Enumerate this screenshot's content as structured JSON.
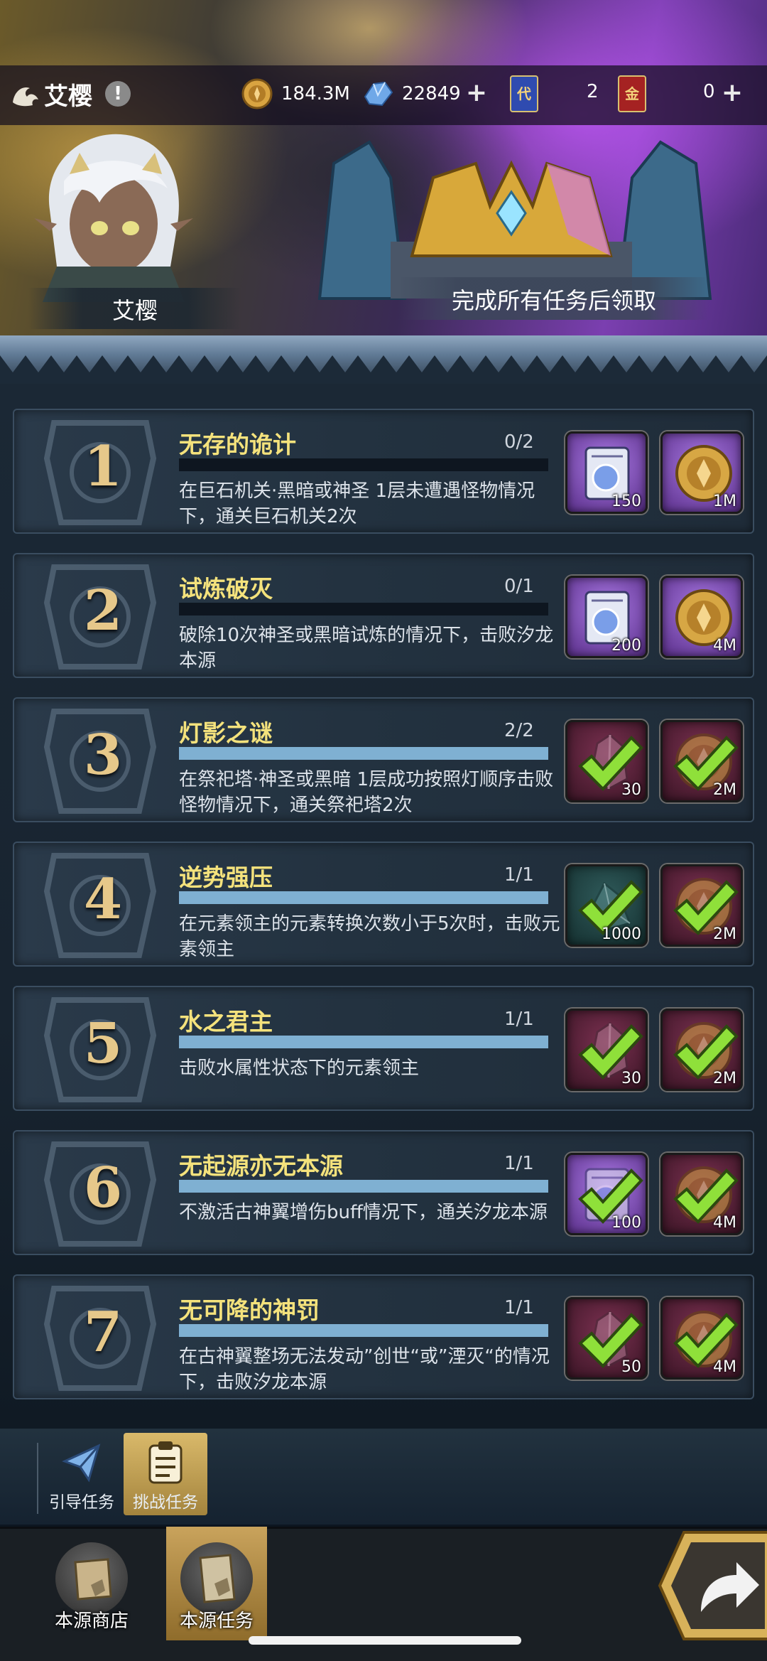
{
  "header": {
    "player_name": "艾樱",
    "info_badge": "!",
    "resources": {
      "gold": "184.3M",
      "crystal": "22849",
      "blue_card_label": "代",
      "blue_card": "2",
      "red_card_label": "金",
      "red_card": "0"
    },
    "plus": "+"
  },
  "hero": {
    "name": "艾樱"
  },
  "chest": {
    "caption": "完成所有任务后领取"
  },
  "tasks": [
    {
      "num": "1",
      "title": "无存的诡计",
      "progress": "0/2",
      "fraction": 0,
      "desc": "在巨石机关·黑暗或神圣 1层未遭遇怪物情况下，通关巨石机关2次",
      "rewards": [
        {
          "icon": "scroll-icon",
          "qty": "150"
        },
        {
          "icon": "gold-coin-icon",
          "qty": "1M"
        }
      ],
      "done": false
    },
    {
      "num": "2",
      "title": "试炼破灭",
      "progress": "0/1",
      "fraction": 0,
      "desc": "破除10次神圣或黑暗试炼的情况下，击败汐龙本源",
      "rewards": [
        {
          "icon": "scroll-icon",
          "qty": "200"
        },
        {
          "icon": "gold-coin-icon",
          "qty": "4M"
        }
      ],
      "done": false
    },
    {
      "num": "3",
      "title": "灯影之谜",
      "progress": "2/2",
      "fraction": 1,
      "desc": "在祭祀塔·神圣或黑暗 1层成功按照灯顺序击败怪物情况下，通关祭祀塔2次",
      "rewards": [
        {
          "icon": "crystal-icon",
          "qty": "30"
        },
        {
          "icon": "gold-coin-icon",
          "qty": "2M"
        }
      ],
      "done": true
    },
    {
      "num": "4",
      "title": "逆势强压",
      "progress": "1/1",
      "fraction": 1,
      "desc": "在元素领主的元素转换次数小于5次时，击败元素领主",
      "rewards": [
        {
          "icon": "shard-icon",
          "qty": "1000"
        },
        {
          "icon": "gold-coin-icon",
          "qty": "2M"
        }
      ],
      "done": true
    },
    {
      "num": "5",
      "title": "水之君主",
      "progress": "1/1",
      "fraction": 1,
      "desc": "击败水属性状态下的元素领主",
      "rewards": [
        {
          "icon": "crystal-icon",
          "qty": "30"
        },
        {
          "icon": "gold-coin-icon",
          "qty": "2M"
        }
      ],
      "done": true
    },
    {
      "num": "6",
      "title": "无起源亦无本源",
      "progress": "1/1",
      "fraction": 1,
      "desc": "不激活古神翼增伤buff情况下，通关汐龙本源",
      "rewards": [
        {
          "icon": "scroll-icon",
          "qty": "100"
        },
        {
          "icon": "gold-coin-icon",
          "qty": "4M"
        }
      ],
      "done": true
    },
    {
      "num": "7",
      "title": "无可降的神罚",
      "progress": "1/1",
      "fraction": 1,
      "desc": "在古神翼整场无法发动”创世“或”湮灭“的情况下，击败汐龙本源",
      "rewards": [
        {
          "icon": "crystal-icon",
          "qty": "50"
        },
        {
          "icon": "gold-coin-icon",
          "qty": "4M"
        }
      ],
      "done": true
    }
  ],
  "subtabs": [
    {
      "label": "引导任务",
      "icon": "paper-plane-icon",
      "active": false
    },
    {
      "label": "挑战任务",
      "icon": "clipboard-icon",
      "active": true
    }
  ],
  "bottom_nav": [
    {
      "label": "本源商店",
      "icon": "shop-scroll-icon",
      "active": false
    },
    {
      "label": "本源任务",
      "icon": "quest-scroll-icon",
      "active": true
    }
  ],
  "colors": {
    "title_yellow": "#f4e27c",
    "progress_fill": "#7fb0d2",
    "check_green": "#8fe03a",
    "tab_gold": "#d9b96a"
  }
}
